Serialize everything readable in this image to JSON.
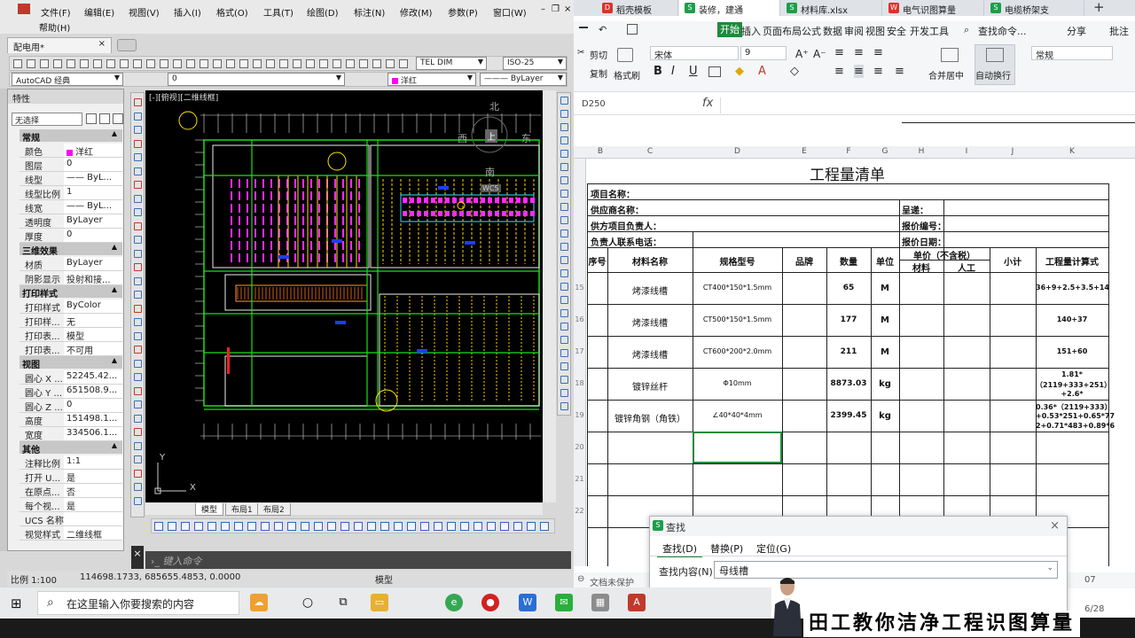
{
  "cad": {
    "menu": [
      "文件(F)",
      "编辑(E)",
      "视图(V)",
      "插入(I)",
      "格式(O)",
      "工具(T)",
      "绘图(D)",
      "标注(N)",
      "修改(M)",
      "参数(P)",
      "窗口(W)",
      "帮助(H)"
    ],
    "doc_tab": "配电用*",
    "close_x": "×",
    "tel_dim": "TEL DIM",
    "iso": "ISO-25",
    "workspace": "AutoCAD 经典",
    "layer": "0",
    "color_combo": "洋红",
    "linetype_combo": "ByLayer",
    "props_title": "特性",
    "no_selection": "无选择",
    "sections": {
      "general": "常规",
      "three_d": "三维效果",
      "plot": "打印样式",
      "view": "视图",
      "misc": "其他"
    },
    "general_rows": [
      {
        "k": "颜色",
        "v": "洋红"
      },
      {
        "k": "图层",
        "v": "0"
      },
      {
        "k": "线型",
        "v": "—— ByL..."
      },
      {
        "k": "线型比例",
        "v": "1"
      },
      {
        "k": "线宽",
        "v": "—— ByL..."
      },
      {
        "k": "透明度",
        "v": "ByLayer"
      },
      {
        "k": "厚度",
        "v": "0"
      }
    ],
    "three_d_rows": [
      {
        "k": "材质",
        "v": "ByLayer"
      },
      {
        "k": "阴影显示",
        "v": "投射和接..."
      }
    ],
    "plot_rows": [
      {
        "k": "打印样式",
        "v": "ByColor"
      },
      {
        "k": "打印样...",
        "v": "无"
      },
      {
        "k": "打印表...",
        "v": "模型"
      },
      {
        "k": "打印表...",
        "v": "不可用"
      }
    ],
    "view_rows": [
      {
        "k": "圆心 X ...",
        "v": "52245.42..."
      },
      {
        "k": "圆心 Y ...",
        "v": "651508.9..."
      },
      {
        "k": "圆心 Z ...",
        "v": "0"
      },
      {
        "k": "高度",
        "v": "151498.1..."
      },
      {
        "k": "宽度",
        "v": "334506.1..."
      }
    ],
    "misc_rows": [
      {
        "k": "注释比例",
        "v": "1:1"
      },
      {
        "k": "打开 U...",
        "v": "是"
      },
      {
        "k": "在原点...",
        "v": "否"
      },
      {
        "k": "每个视...",
        "v": "是"
      },
      {
        "k": "UCS 名称",
        "v": ""
      },
      {
        "k": "视觉样式",
        "v": "二维线框"
      }
    ],
    "viewport_label": "[-][俯视][二维线框]",
    "compass": {
      "n": "北",
      "s": "南",
      "e": "东",
      "w": "西",
      "top": "上"
    },
    "wcs": "WCS",
    "axis_y": "Y",
    "axis_x": "X",
    "layout_tabs": [
      "模型",
      "布局1",
      "布局2"
    ],
    "command_prompt": "键入命令",
    "scale": "比例 1:100",
    "coords": "114698.1733, 685655.4853, 0.0000",
    "model": "模型"
  },
  "wps": {
    "tabs": [
      {
        "label": "稻壳模板",
        "color": "#d9342b",
        "icon": "D"
      },
      {
        "label": "装修，建通",
        "color": "#1f9d4b",
        "icon": "S"
      },
      {
        "label": "材料库.xlsx",
        "color": "#1f9d4b",
        "icon": "S"
      },
      {
        "label": "电气识图算量",
        "color": "#d9342b",
        "icon": "W"
      },
      {
        "label": "电缆桥架支",
        "color": "#1f9d4b",
        "icon": "S"
      }
    ],
    "tab_plus": "+",
    "menu": [
      "开始",
      "插入",
      "页面布局",
      "公式",
      "数据",
      "审阅",
      "视图",
      "安全",
      "开发工具"
    ],
    "find_cmd": "查找命令...",
    "share": "分享",
    "annotate": "批注",
    "ribbon": {
      "cut": "剪切",
      "copy": "复制",
      "format_painter": "格式刷",
      "paste": "粘贴",
      "font": "宋体",
      "size": "9",
      "merge": "合并居中",
      "wrap": "自动换行",
      "number_format": "常规",
      "start_tip": "开始"
    },
    "name_box": "D250",
    "fx": "fx",
    "columns": [
      "B",
      "C",
      "D",
      "E",
      "F",
      "G",
      "H",
      "I",
      "J",
      "K"
    ],
    "row_numbers": [
      "",
      "",
      "",
      "",
      "",
      "",
      "15",
      "16",
      "17",
      "18",
      "19",
      "20",
      "21",
      "22"
    ],
    "sheet": {
      "title": "工程量清单",
      "project_name": "项目名称：",
      "supplier": "供应商名称：",
      "to": "呈递：",
      "supplier_manager": "供方项目负责人：",
      "quote_no": "报价编号：",
      "contact_phone": "负责人联系电话：",
      "quote_date": "报价日期：",
      "headers": {
        "seq": "序号",
        "material": "材料名称",
        "spec": "规格型号",
        "brand": "品牌",
        "qty": "数量",
        "unit": "单位",
        "unit_price": "单价（不含税）",
        "mat": "材料",
        "labor": "人工",
        "subtotal": "小计",
        "formula": "工程量计算式"
      },
      "rows": [
        {
          "name": "烤漆线槽",
          "spec": "CT400*150*1.5mm",
          "qty": "65",
          "unit": "M",
          "formula": [
            "36+9+2.5+3.5+14"
          ]
        },
        {
          "name": "烤漆线槽",
          "spec": "CT500*150*1.5mm",
          "qty": "177",
          "unit": "M",
          "formula": [
            "140+37"
          ]
        },
        {
          "name": "烤漆线槽",
          "spec": "CT600*200*2.0mm",
          "qty": "211",
          "unit": "M",
          "formula": [
            "151+60"
          ]
        },
        {
          "name": "镀锌丝杆",
          "spec": "Φ10mm",
          "qty": "8873.03",
          "unit": "kg",
          "formula": [
            "1.81*",
            "（2119+333+251）",
            "+2.6*"
          ]
        },
        {
          "name": "镀锌角钢（角铁）",
          "spec": "∠40*40*4mm",
          "qty": "2399.45",
          "unit": "kg",
          "formula": [
            "0.36*（2119+333）",
            "+0.53*251+0.65*77",
            "2+0.71*483+0.89*6"
          ]
        }
      ]
    },
    "find": {
      "title": "查找",
      "tabs": [
        "查找(D)",
        "替换(P)",
        "定位(G)"
      ],
      "label": "查找内容(N):",
      "value": "母线槽"
    },
    "status": "文档未保护",
    "status_right": [
      "07",
      "6/28"
    ]
  },
  "taskbar": {
    "search_placeholder": "在这里输入你要搜索的内容"
  },
  "banner": "田工教你洁净工程识图算量"
}
